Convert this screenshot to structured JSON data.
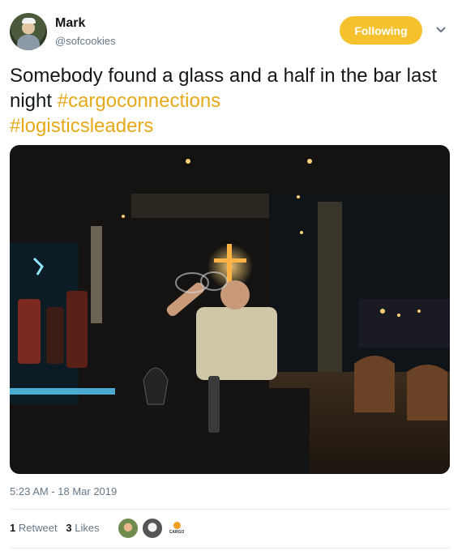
{
  "author": {
    "name": "Mark",
    "handle": "@sofcookies"
  },
  "follow_button": {
    "label": "Following"
  },
  "tweet": {
    "text": "Somebody found a glass and a half in the bar last night",
    "hashtags": [
      "#cargoconnections",
      "#logisticsleaders"
    ]
  },
  "timestamp": "5:23 AM - 18 Mar 2019",
  "stats": {
    "retweets_count": "1",
    "retweets_label": "Retweet",
    "likes_count": "3",
    "likes_label": "Likes"
  },
  "liker_avatar_logo_text": "CARGO",
  "colors": {
    "accent": "#f5c22e",
    "hashtag": "#e6a919",
    "muted": "#657786"
  }
}
